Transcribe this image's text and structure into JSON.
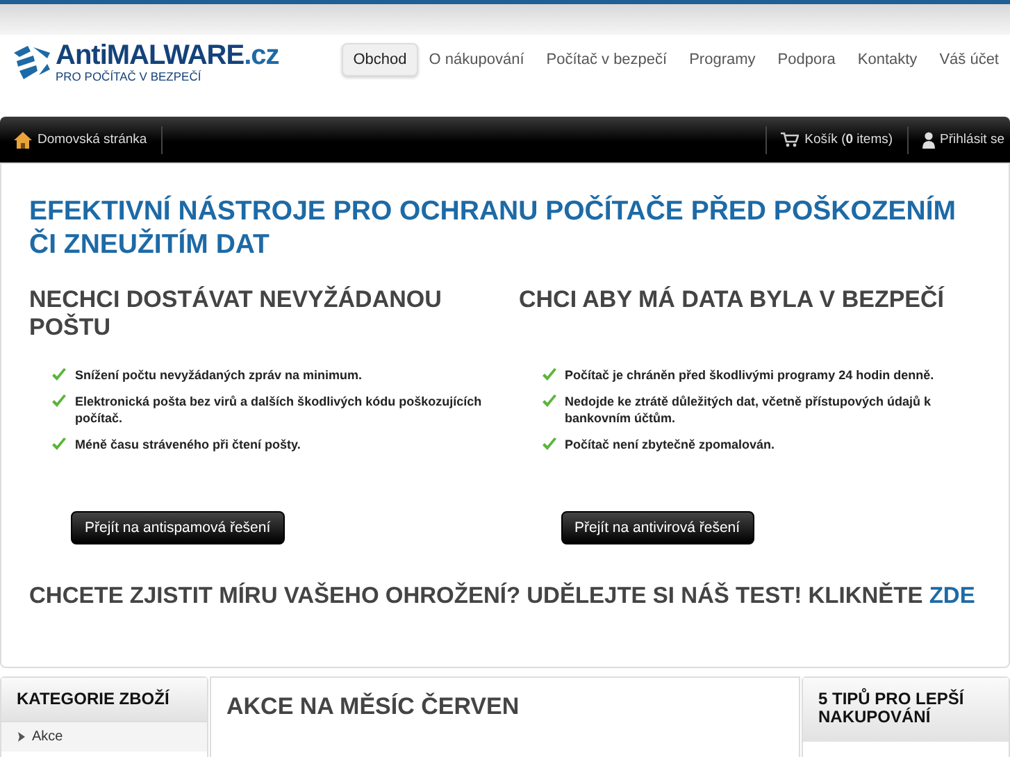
{
  "logo": {
    "name": "AntiMALWARE",
    "domain": ".cz",
    "tagline": "PRO POČÍTAČ V BEZPEČÍ"
  },
  "nav": [
    {
      "label": "Obchod",
      "selected": true
    },
    {
      "label": "O nákupování",
      "selected": false
    },
    {
      "label": "Počítač v bezpečí",
      "selected": false
    },
    {
      "label": "Programy",
      "selected": false
    },
    {
      "label": "Podpora",
      "selected": false
    },
    {
      "label": "Kontakty",
      "selected": false
    },
    {
      "label": "Váš účet",
      "selected": false
    }
  ],
  "toolbar": {
    "home": "Domovská stránka",
    "cart_prefix": "Košík (",
    "cart_count": "0",
    "cart_suffix": " items)",
    "login": "Přihlásit se"
  },
  "headline": "EFEKTIVNÍ NÁSTROJE PRO OCHRANU POČÍTAČE PŘED POŠKOZENÍM ČI ZNEUŽITÍM DAT",
  "columns": [
    {
      "title": "NECHCI DOSTÁVAT NEVYŽÁDANOU POŠTU",
      "points": [
        "Snížení počtu nevyžádaných zpráv na minimum.",
        "Elektronická pošta bez virů a dalších škodlivých kódu poškozujících počítač.",
        "Méně času stráveného při čtení pošty."
      ],
      "button": "Přejít na antispamová řešení"
    },
    {
      "title": "CHCI ABY MÁ DATA BYLA V BEZPEČÍ",
      "points": [
        "Počítač je chráněn před škodlivými programy 24 hodin denně.",
        "Nedojde ke ztrátě důležitých dat, včetně přístupových údajů k bankovním účtům.",
        "Počítač není zbytečně zpomalován."
      ],
      "button": "Přejít na antivirová řešení"
    }
  ],
  "cta": {
    "text": "CHCETE ZJISTIT MÍRU VAŠEHO OHROŽENÍ? UDĚLEJTE SI NÁŠ TEST! KLIKNĚTE",
    "link": "ZDE"
  },
  "categories": {
    "title": "KATEGORIE ZBOŽÍ",
    "items": [
      "Akce"
    ]
  },
  "main_title": "AKCE NA MĚSÍC ČERVEN",
  "tips_title": "5 TIPŮ PRO LEPŠÍ NAKUPOVÁNÍ"
}
